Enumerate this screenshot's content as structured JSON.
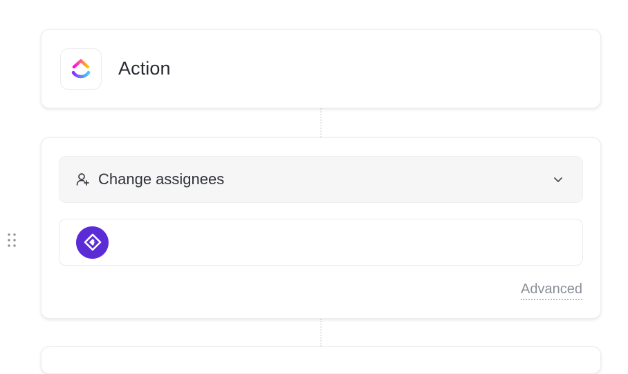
{
  "header": {
    "title": "Action",
    "logo_icon": "clickup-logo-icon"
  },
  "action": {
    "select_label": "Change assignees",
    "select_icon": "user-add-icon",
    "chevron_icon": "chevron-down-icon",
    "assignee_avatar_icon": "integration-avatar-icon",
    "advanced_label": "Advanced"
  },
  "colors": {
    "avatar": "#5b2bd6",
    "select_bg": "#f6f6f7",
    "link": "#8a8f98"
  }
}
